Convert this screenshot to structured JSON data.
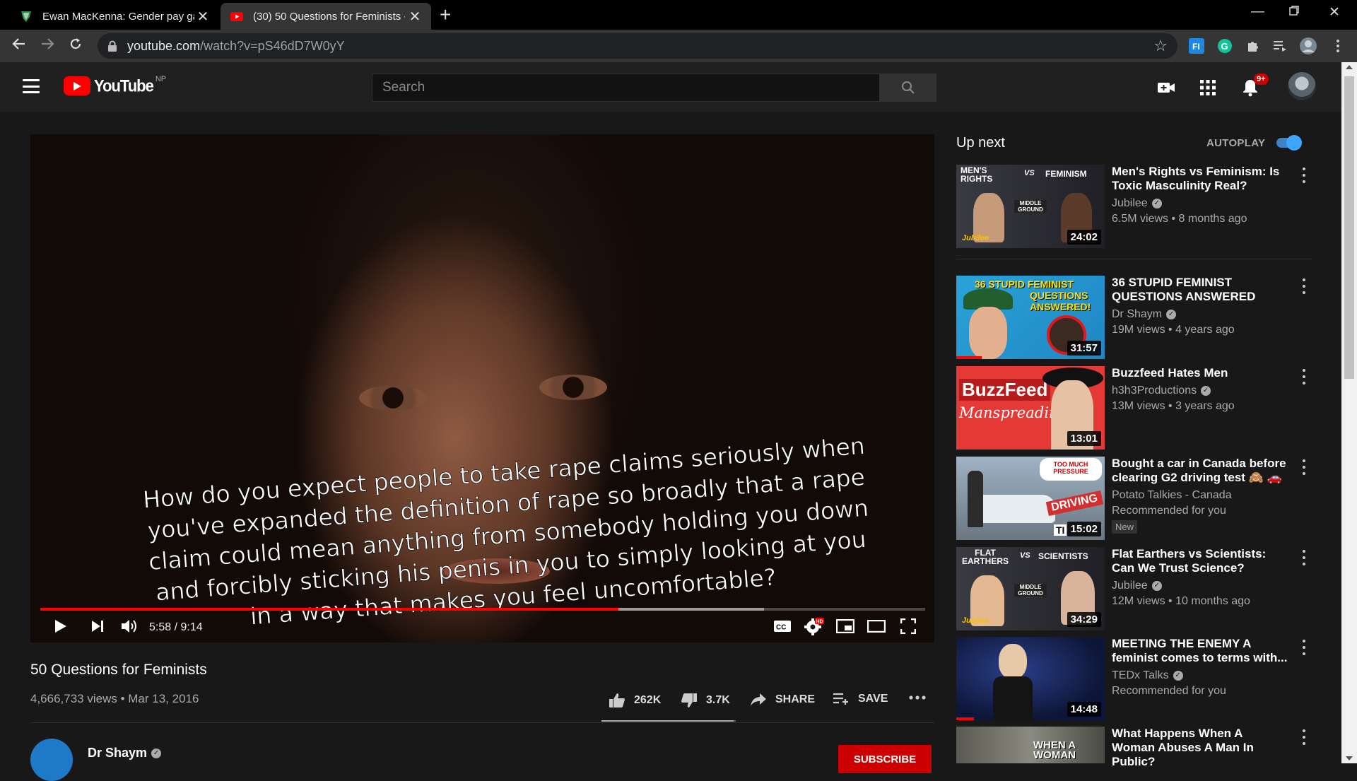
{
  "browser": {
    "tabs": [
      {
        "title": "Ewan MacKenna: Gender pay gap",
        "active": false
      },
      {
        "title": "(30) 50 Questions for Feminists -",
        "active": true
      }
    ],
    "url_host": "youtube.com",
    "url_path": "/watch?v=pS46dD7W0yY"
  },
  "masthead": {
    "logo_text": "YouTube",
    "region": "NP",
    "search_placeholder": "Search",
    "notification_count": "9+"
  },
  "player": {
    "caption_lines": [
      "How do you expect people to take rape claims seriously when",
      "you've expanded the definition of rape so broadly that a rape",
      "claim could mean anything from somebody holding you down",
      "and forcibly sticking his penis in you to simply looking at you",
      "in a way that makes you feel uncomfortable?"
    ],
    "time_display": "5:58 / 9:14",
    "played_fraction": 0.653,
    "buffered_fraction": 0.818
  },
  "video": {
    "title": "50 Questions for Feminists",
    "meta": "4,666,733 views • Mar 13, 2016",
    "likes": "262K",
    "dislikes": "3.7K",
    "share_label": "SHARE",
    "save_label": "SAVE",
    "like_ratio": 0.986,
    "channel": "Dr Shaym",
    "subscribe_label": "SUBSCRIBE"
  },
  "sidebar": {
    "heading": "Up next",
    "autoplay_label": "AUTOPLAY",
    "autoplay_on": true,
    "items": [
      {
        "title": "Men's Rights vs Feminism: Is Toxic Masculinity Real?",
        "channel": "Jubilee",
        "verified": true,
        "meta": "6.5M views • 8 months ago",
        "duration": "24:02",
        "watched": 0,
        "thumb_text_1": "MEN'S RIGHTS",
        "thumb_text_2": "VS",
        "thumb_text_3": "FEMINISM",
        "thumb_text_4": "MIDDLE GROUND",
        "thumb_text_5": "Jubilee"
      },
      {
        "title": "36 STUPID FEMINIST QUESTIONS ANSWERED",
        "channel": "Dr Shaym",
        "verified": true,
        "meta": "19M views • 4 years ago",
        "duration": "31:57",
        "watched": 0.17,
        "thumb_text_1": "36 STUPID FEMINIST",
        "thumb_text_2": "QUESTIONS",
        "thumb_text_3": "ANSWERED!"
      },
      {
        "title": "Buzzfeed Hates Men",
        "channel": "h3h3Productions",
        "verified": true,
        "meta": "13M views • 3 years ago",
        "duration": "13:01",
        "watched": 0,
        "thumb_text_1": "BuzzFeed",
        "thumb_text_2": "Manspreading"
      },
      {
        "title": "Bought a car in Canada before clearing G2 driving test 🙈 🚗",
        "channel": "Potato Talkies - Canada",
        "verified": false,
        "meta": "Recommended for you",
        "badge": "New",
        "duration": "15:02",
        "watched": 0,
        "thumb_text_1": "TOO MUCH PRESSURE",
        "thumb_text_2": "DRIVING",
        "thumb_text_3": "TI"
      },
      {
        "title": "Flat Earthers vs Scientists: Can We Trust Science?",
        "channel": "Jubilee",
        "verified": true,
        "meta": "12M views • 10 months ago",
        "duration": "34:29",
        "watched": 0,
        "thumb_text_1": "FLAT EARTHERS",
        "thumb_text_2": "VS",
        "thumb_text_3": "SCIENTISTS",
        "thumb_text_4": "MIDDLE GROUND",
        "thumb_text_5": "Jubilee"
      },
      {
        "title": "MEETING THE ENEMY A feminist comes to terms with...",
        "channel": "TEDx Talks",
        "verified": true,
        "meta": "Recommended for you",
        "duration": "14:48",
        "watched": 0.12
      },
      {
        "title": "What Happens When A Woman Abuses A Man In Public?",
        "channel": "",
        "verified": false,
        "meta": "",
        "duration": "",
        "watched": 0,
        "thumb_text_1": "WHEN A WOMAN"
      }
    ]
  },
  "colors": {
    "brand_red": "#ff0000",
    "subscribe_red": "#cc0000",
    "autoplay_blue": "#3ea6ff",
    "background": "#181818"
  }
}
